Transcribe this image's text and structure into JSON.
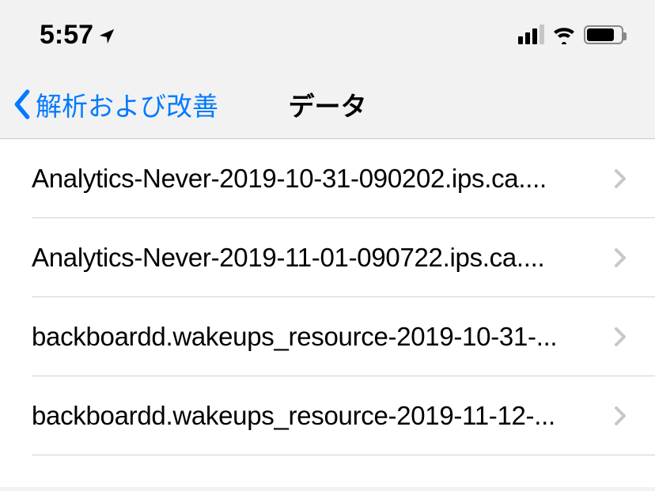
{
  "status": {
    "time": "5:57"
  },
  "nav": {
    "back_label": "解析および改善",
    "title": "データ"
  },
  "rows": [
    {
      "label": "Analytics-Never-2019-10-31-090202.ips.ca...."
    },
    {
      "label": "Analytics-Never-2019-11-01-090722.ips.ca...."
    },
    {
      "label": "backboardd.wakeups_resource-2019-10-31-..."
    },
    {
      "label": "backboardd.wakeups_resource-2019-11-12-..."
    }
  ]
}
